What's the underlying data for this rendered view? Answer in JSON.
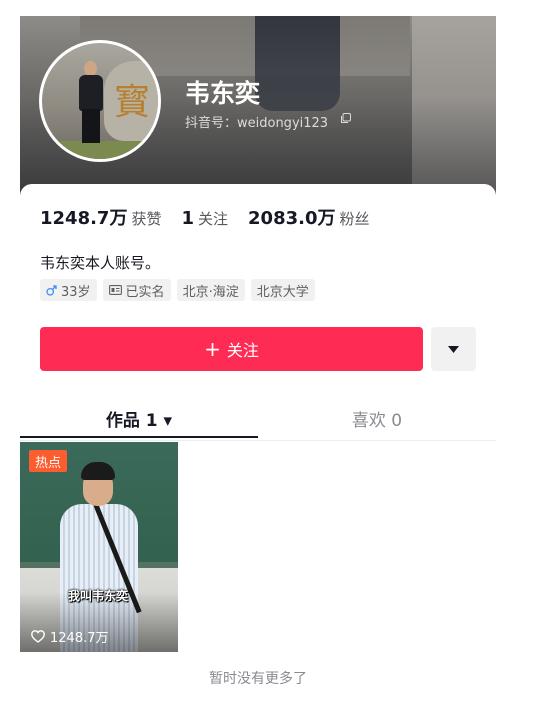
{
  "profile": {
    "name": "韦东奕",
    "douyin_id": "抖音号：weidongyi123",
    "bio": "韦东奕本人账号。"
  },
  "stats": [
    {
      "value": "1248.7万",
      "label": "获赞"
    },
    {
      "value": "1",
      "label": "关注"
    },
    {
      "value": "2083.0万",
      "label": "粉丝"
    }
  ],
  "tags": {
    "age": "33岁",
    "verified": "已实名",
    "location": "北京·海淀",
    "school": "北京大学"
  },
  "actions": {
    "follow_label": "关注",
    "follow_plus": "+"
  },
  "tabs": {
    "works": "作品 1 ▾",
    "likes": "喜欢 0"
  },
  "video": {
    "badge": "热点",
    "caption": "我叫韦东奕",
    "likes": "1248.7万"
  },
  "footer": "暂时没有更多了",
  "colors": {
    "accent": "#fe2c55",
    "hot_badge": "#fd5c2e"
  },
  "icons": [
    "copy-icon",
    "male-icon",
    "id-card-icon",
    "dropdown-arrow-icon",
    "heart-icon"
  ]
}
